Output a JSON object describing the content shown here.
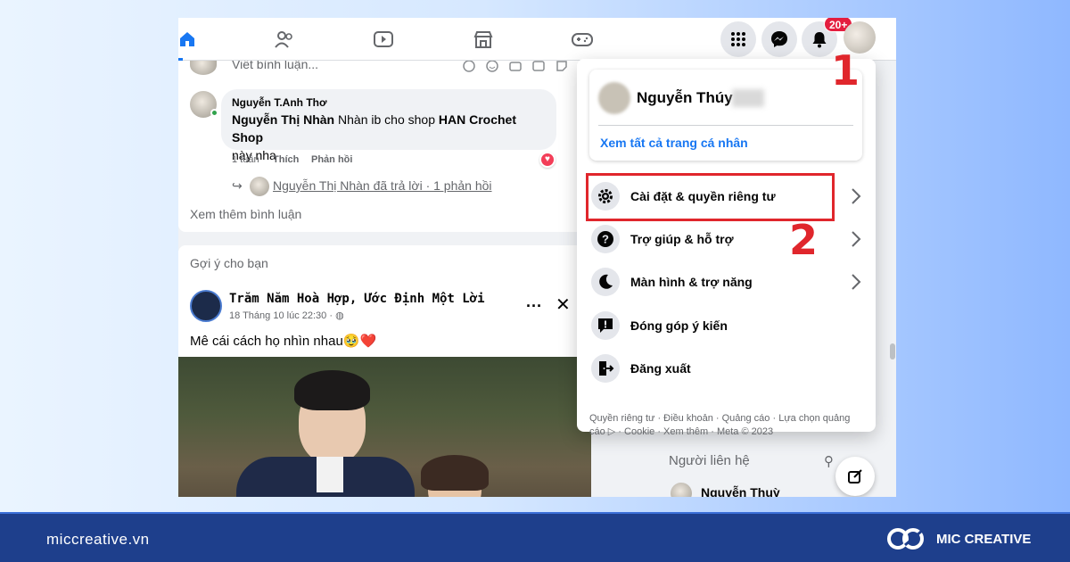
{
  "feed": {
    "comment_placeholder": "Viết bình luận...",
    "comment": {
      "author": "Nguyễn T.Anh Thơ",
      "mention": "Nguyễn Thị Nhàn",
      "text": " Nhàn ib cho shop ",
      "shop": "HAN Crochet Shop",
      "text_end": "này nha",
      "time": "1 tuần",
      "like": "Thích",
      "reply": "Phản hồi"
    },
    "reply_line": "Nguyễn Thị Nhàn đã trả lời · 1 phản hồi",
    "more_comments": "Xem thêm bình luận",
    "suggest_label": "Gợi ý cho bạn",
    "post": {
      "page_name": "Trăm Năm Hoà Hợp, Ước Định Một Lời",
      "time": "18 Tháng 10 lúc 22:30 · ",
      "text": "Mê cái cách họ nhìn nhau🥹❤️"
    }
  },
  "topbar": {
    "notification_badge": "20+"
  },
  "menu": {
    "profile_name": "Nguyễn Thúy",
    "see_all_profiles": "Xem tất cả trang cá nhân",
    "items": [
      {
        "label": "Cài đặt & quyền riêng tư",
        "icon": "gear-icon"
      },
      {
        "label": "Trợ giúp & hỗ trợ",
        "icon": "help-icon"
      },
      {
        "label": "Màn hình & trợ năng",
        "icon": "moon-icon"
      },
      {
        "label": "Đóng góp ý kiến",
        "icon": "feedback-icon"
      },
      {
        "label": "Đăng xuất",
        "icon": "logout-icon"
      }
    ],
    "footer": "Quyền riêng tư · Điều khoản · Quảng cáo · Lựa chọn quảng cáo ▷ · Cookie · Xem thêm · Meta © 2023"
  },
  "sidebar": {
    "contacts_label": "Người liên hệ",
    "contact_name": "Nguyễn Thuỳ"
  },
  "annotations": {
    "step1": "1",
    "step2": "2",
    "highlight_color": "#e0262c"
  },
  "banner": {
    "site": "miccreative.vn",
    "brand": "MIC CREATIVE"
  }
}
